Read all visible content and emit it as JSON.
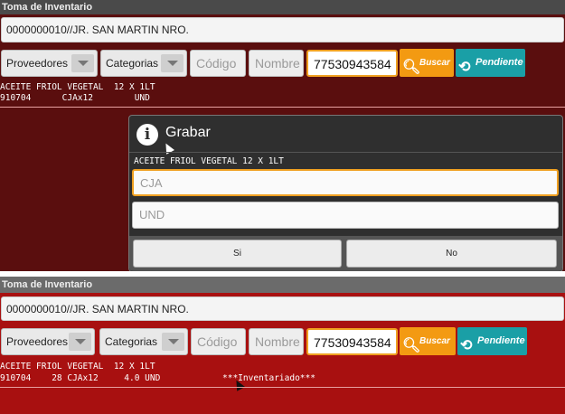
{
  "top": {
    "title": "Toma de Inventario",
    "client": "0000000010//JR. SAN MARTIN NRO.",
    "proveedores": "Proveedores",
    "categorias": "Categorias",
    "codigo_placeholder": "Código",
    "nombre_placeholder": "Nombre",
    "barcode": "77530943584",
    "buscar": "Buscar",
    "pendiente": "Pendiente",
    "product_line1": "ACEITE FRIOL VEGETAL  12 X 1LT",
    "product_line2": "910704      CJAx12        UND"
  },
  "dialog": {
    "title": "Grabar",
    "message": "ACEITE FRIOL VEGETAL  12 X 1LT",
    "cja_placeholder": "CJA",
    "und_placeholder": "UND",
    "si": "Si",
    "no": "No"
  },
  "bottom": {
    "title": "Toma de Inventario",
    "client": "0000000010//JR. SAN MARTIN NRO.",
    "proveedores": "Proveedores",
    "categorias": "Categorias",
    "codigo_placeholder": "Código",
    "nombre_placeholder": "Nombre",
    "barcode": "77530943584",
    "buscar": "Buscar",
    "pendiente": "Pendiente",
    "product_line1": "ACEITE FRIOL VEGETAL  12 X 1LT",
    "product_line2": "910704    28 CJAx12     4.0 UND",
    "status": "***Inventariado***"
  },
  "colors": {
    "top_background": "#5a0e0e",
    "bottom_background": "#a81010",
    "buscar_orange": "#f39a12",
    "pendiente_teal": "#1a9fa6",
    "focus_orange": "#f0a020"
  },
  "icons": {
    "search": "search-icon",
    "pending": "pending-icon",
    "info": "info-icon",
    "dropdown": "chevron-down-icon"
  }
}
